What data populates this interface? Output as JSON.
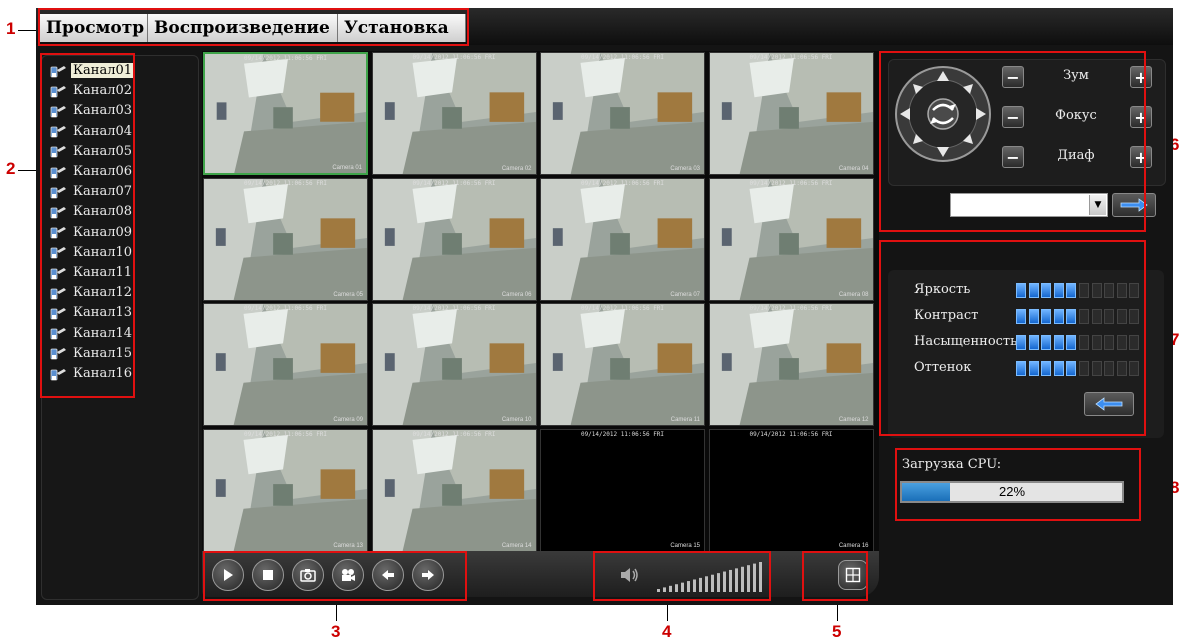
{
  "menu": {
    "tabs": [
      {
        "label": "Просмотр"
      },
      {
        "label": "Воспроизведение"
      },
      {
        "label": "Установка"
      }
    ]
  },
  "channels": [
    {
      "label": "Канал01",
      "selected": true
    },
    {
      "label": "Канал02"
    },
    {
      "label": "Канал03"
    },
    {
      "label": "Канал04"
    },
    {
      "label": "Канал05"
    },
    {
      "label": "Канал06"
    },
    {
      "label": "Канал07"
    },
    {
      "label": "Канал08"
    },
    {
      "label": "Канал09"
    },
    {
      "label": "Канал10"
    },
    {
      "label": "Канал11"
    },
    {
      "label": "Канал12"
    },
    {
      "label": "Канал13"
    },
    {
      "label": "Канал14"
    },
    {
      "label": "Канал15"
    },
    {
      "label": "Канал16"
    }
  ],
  "video_grid": {
    "tiles": [
      {
        "camera": "Camera 01",
        "has_feed": true,
        "selected": true
      },
      {
        "camera": "Camera 02",
        "has_feed": true
      },
      {
        "camera": "Camera 03",
        "has_feed": true
      },
      {
        "camera": "Camera 04",
        "has_feed": true
      },
      {
        "camera": "Camera 05",
        "has_feed": true
      },
      {
        "camera": "Camera 06",
        "has_feed": true
      },
      {
        "camera": "Camera 07",
        "has_feed": true
      },
      {
        "camera": "Camera 08",
        "has_feed": true
      },
      {
        "camera": "Camera 09",
        "has_feed": true
      },
      {
        "camera": "Camera 10",
        "has_feed": true
      },
      {
        "camera": "Camera 11",
        "has_feed": true
      },
      {
        "camera": "Camera 12",
        "has_feed": true
      },
      {
        "camera": "Camera 13",
        "has_feed": true
      },
      {
        "camera": "Camera 14",
        "has_feed": true
      },
      {
        "camera": "Camera 15",
        "has_feed": false
      },
      {
        "camera": "Camera 16",
        "has_feed": false
      }
    ],
    "timestamp": "09/14/2012 11:06:56 FRI"
  },
  "toolbar": {
    "buttons": [
      "play-icon",
      "stop-icon",
      "snapshot-icon",
      "record-icon",
      "prev-icon",
      "next-icon"
    ],
    "volume_icon": "speaker-icon",
    "volume_level": 1.0,
    "layout_icon": "split-screen-icon"
  },
  "ptz": {
    "zoom_label": "Зум",
    "focus_label": "Фокус",
    "iris_label": "Диаф",
    "minus": "−",
    "plus": "+",
    "preset_value": "",
    "preset_arrow": "▼"
  },
  "color_adjust": {
    "rows": [
      {
        "label": "Яркость",
        "level": 5,
        "max": 10
      },
      {
        "label": "Контраст",
        "level": 5,
        "max": 10
      },
      {
        "label": "Насыщенность",
        "level": 5,
        "max": 10
      },
      {
        "label": "Оттенок",
        "level": 5,
        "max": 10
      }
    ]
  },
  "cpu": {
    "label": "Загрузка CPU:",
    "percent_text": "22%",
    "fraction": 0.22
  },
  "annotations": [
    "1",
    "2",
    "3",
    "4",
    "5",
    "6",
    "7",
    "8"
  ],
  "colors": {
    "accent_blue": "#1467d0",
    "annotation_red": "#e01010",
    "selected_green": "#3fa44a"
  }
}
